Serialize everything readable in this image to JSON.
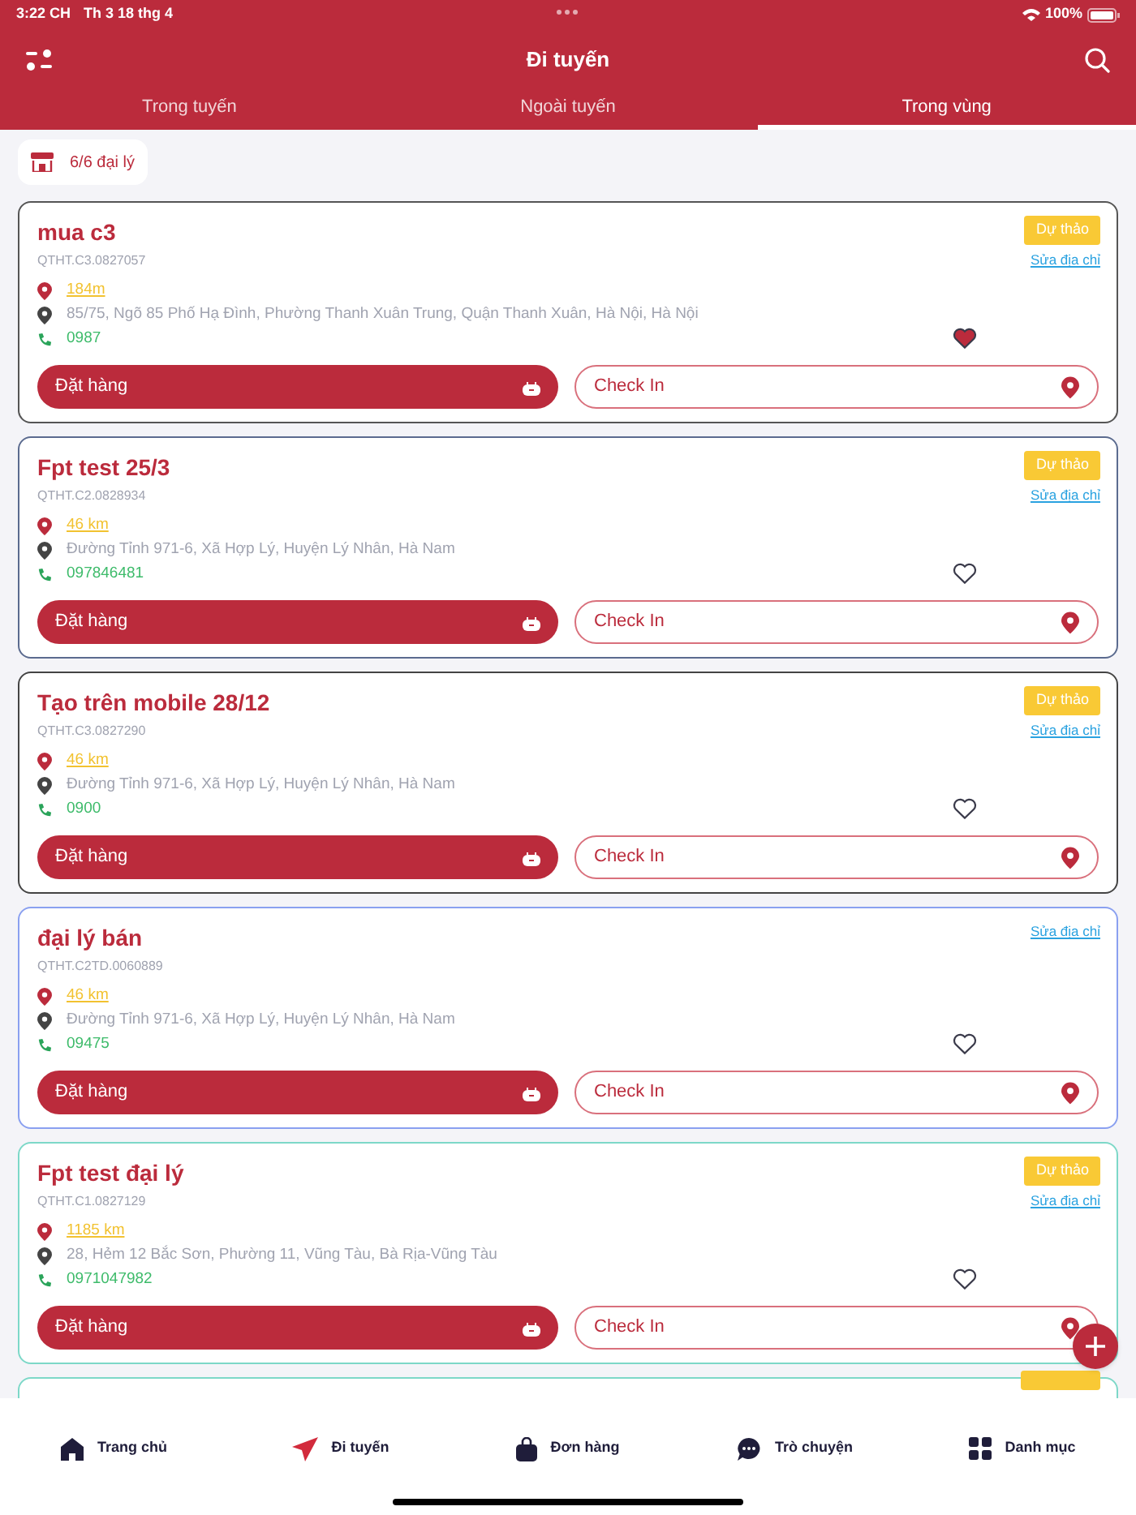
{
  "status_bar": {
    "time": "3:22 CH",
    "date": "Th 3 18 thg 4",
    "battery": "100%"
  },
  "header": {
    "title": "Đi tuyến"
  },
  "tabs": [
    {
      "label": "Trong tuyến",
      "selected": false
    },
    {
      "label": "Ngoài tuyến",
      "selected": false
    },
    {
      "label": "Trong vùng",
      "selected": true
    }
  ],
  "agency_count": "6/6 đại lý",
  "stores": [
    {
      "name": "mua c3",
      "code": "QTHT.C3.0827057",
      "distance": "184m",
      "address": "85/75, Ngõ 85 Phố Hạ Đình, Phường Thanh Xuân Trung, Quận Thanh Xuân, Hà Nội, Hà Nội",
      "phone": "0987",
      "badge": "Dự thảo",
      "edit_link": "Sửa địa chỉ",
      "favorite": true,
      "color": "#555555",
      "order_button": "Đặt hàng",
      "checkin_button": "Check In"
    },
    {
      "name": "Fpt test 25/3",
      "code": "QTHT.C2.0828934",
      "distance": "46 km",
      "address": "Đường Tỉnh 971-6, Xã Hợp Lý, Huyện Lý Nhân, Hà Nam",
      "phone": "097846481",
      "badge": "Dự thảo",
      "edit_link": "Sửa địa chỉ",
      "favorite": false,
      "color": "#5b6b8f",
      "order_button": "Đặt hàng",
      "checkin_button": "Check In"
    },
    {
      "name": "Tạo trên mobile 28/12",
      "code": "QTHT.C3.0827290",
      "distance": "46 km",
      "address": "Đường Tỉnh 971-6, Xã Hợp Lý, Huyện Lý Nhân, Hà Nam",
      "phone": "0900",
      "badge": "Dự thảo",
      "edit_link": "Sửa địa chỉ",
      "favorite": false,
      "color": "#444444",
      "order_button": "Đặt hàng",
      "checkin_button": "Check In"
    },
    {
      "name": "đại lý bán",
      "code": "QTHT.C2TD.0060889",
      "distance": "46 km",
      "address": "Đường Tỉnh 971-6, Xã Hợp Lý, Huyện Lý Nhân, Hà Nam",
      "phone": "09475",
      "edit_link": "Sửa địa chỉ",
      "favorite": false,
      "color": "#8aa0f0",
      "order_button": "Đặt hàng",
      "checkin_button": "Check In"
    },
    {
      "name": "Fpt test đại lý",
      "code": "QTHT.C1.0827129",
      "distance": "1185 km",
      "address": "28, Hẻm 12 Bắc Sơn, Phường 11, Vũng Tàu, Bà Rịa-Vũng Tàu",
      "phone": "0971047982",
      "badge": "Dự thảo",
      "edit_link": "Sửa địa chỉ",
      "favorite": false,
      "color": "#7dd8c8",
      "order_button": "Đặt hàng",
      "checkin_button": "Check In"
    },
    {
      "color": "#7dd8c8"
    }
  ],
  "bottom_nav": [
    {
      "label": "Trang chủ",
      "selected": false
    },
    {
      "label": "Đi tuyến",
      "selected": true
    },
    {
      "label": "Đơn hàng",
      "selected": false
    },
    {
      "label": "Trò chuyện",
      "selected": false
    },
    {
      "label": "Danh mục",
      "selected": false
    }
  ]
}
